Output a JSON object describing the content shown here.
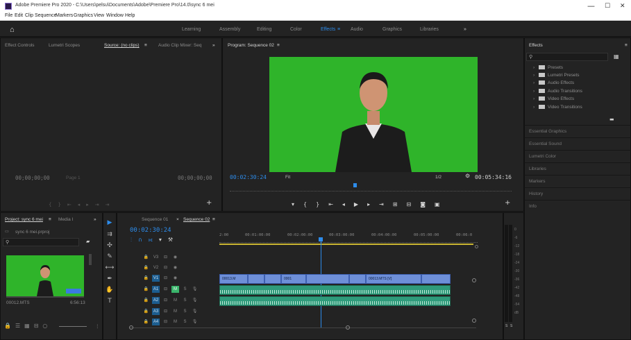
{
  "window": {
    "title": "Adobe Premiere Pro 2020 - C:\\Users\\pelsu\\Documents\\Adobe\\Premiere Pro\\14.0\\sync 6 mei",
    "minimize": "—",
    "maximize": "☐",
    "close": "✕"
  },
  "menu": [
    "File",
    "Edit",
    "Clip",
    "Sequence",
    "Markers",
    "Graphics",
    "View",
    "Window",
    "Help"
  ],
  "workspaces": {
    "items": [
      "Learning",
      "Assembly",
      "Editing",
      "Color",
      "Effects",
      "Audio",
      "Graphics",
      "Libraries"
    ],
    "active": "Effects",
    "active_menu": "≡",
    "more": "»",
    "home": "⌂"
  },
  "source_panel": {
    "tabs": [
      "Effect Controls",
      "Lumetri Scopes",
      "Source: (no clips)",
      "Audio Clip Mixer: Seq"
    ],
    "menu": "≡",
    "more": "»",
    "timecode_in": "00;00;00;00",
    "timecode_out": "00;00;00;00",
    "page": "Page 1"
  },
  "program_panel": {
    "tab": "Program: Sequence 02",
    "menu": "≡",
    "timecode": "00:02:30:24",
    "fit": "Fit",
    "ratio": "1/2",
    "duration": "00:05:34:16"
  },
  "effects_panel": {
    "title": "Effects",
    "menu": "≡",
    "search_placeholder": "",
    "folders": [
      "Presets",
      "Lumetri Presets",
      "Audio Effects",
      "Audio Transitions",
      "Video Effects",
      "Video Transitions"
    ],
    "sections": [
      "Essential Graphics",
      "Essential Sound",
      "Lumetri Color",
      "Libraries",
      "Markers",
      "History",
      "Info"
    ]
  },
  "project_panel": {
    "tabs": [
      "Project: sync 6 mei",
      "Media I"
    ],
    "more": "»",
    "menu": "≡",
    "file": "sync 6 mei.prproj",
    "clip_name": "00012.MTS",
    "clip_duration": "6:56:13"
  },
  "timeline": {
    "tabs": [
      "Sequence 01",
      "Sequence 02"
    ],
    "active_tab": "Sequence 02",
    "close": "×",
    "menu": "≡",
    "timecode": "00:02:30:24",
    "ruler": [
      "2:00",
      "00:01:00:00",
      "00:02:00:00",
      "00:03:00:00",
      "00:04:00:00",
      "00:05:00:00",
      "00:06:0"
    ],
    "video_tracks": [
      "V3",
      "V2",
      "V1"
    ],
    "audio_tracks": [
      "A1",
      "A2",
      "A3",
      "A4"
    ],
    "track_letters": {
      "mute": "M",
      "solo": "S"
    },
    "clip_labels": [
      "00013.M",
      "0001",
      "00013.MTS [V]"
    ],
    "playhead_fraction": 0.43
  },
  "meters": {
    "scale": [
      "0",
      "-6",
      "-12",
      "-18",
      "-24",
      "-30",
      "-36",
      "-42",
      "-48",
      "-54",
      "dB"
    ],
    "solo_labels": [
      "S",
      "S"
    ]
  },
  "colors": {
    "accent": "#2d8ceb",
    "chroma_green": "#2fb42a",
    "video_clip": "#6e8fd8",
    "audio_clip": "#2f9b7b",
    "timecode": "#2d8ceb"
  }
}
